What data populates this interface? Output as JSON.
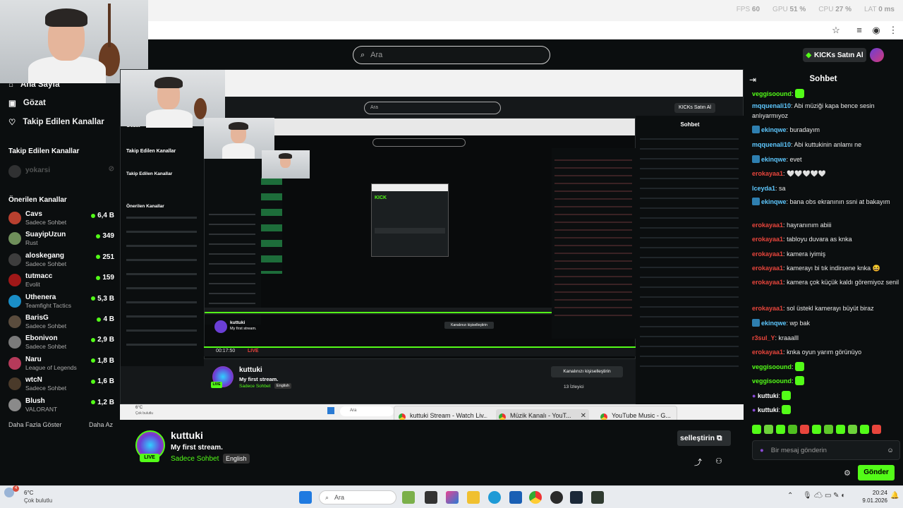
{
  "stats": {
    "fps_label": "FPS",
    "fps": "60",
    "gpu_label": "GPU",
    "gpu": "51 %",
    "cpu_label": "CPU",
    "cpu": "27 %",
    "lat_label": "LAT",
    "lat": "0 ms"
  },
  "search": {
    "placeholder": "Ara"
  },
  "header": {
    "buy_kicks": "KICKs Satın Al"
  },
  "sidebar": {
    "nav": [
      {
        "label": "Ana Sayfa",
        "icon": "home-icon"
      },
      {
        "label": "Gözat",
        "icon": "browse-icon"
      },
      {
        "label": "Takip Edilen Kanallar",
        "icon": "heart-icon"
      }
    ],
    "followed_title": "Takip Edilen Kanallar",
    "followed": [
      {
        "name": "yokarsi"
      }
    ],
    "recommended_title": "Önerilen Kanallar",
    "recommended": [
      {
        "name": "Cavs",
        "category": "Sadece Sohbet",
        "viewers": "6,4 B",
        "color": "#b8402f"
      },
      {
        "name": "SuayipUzun",
        "category": "Rust",
        "viewers": "349",
        "color": "#6f8f5a"
      },
      {
        "name": "aloskegang",
        "category": "Sadece Sohbet",
        "viewers": "251",
        "color": "#3d3d3d"
      },
      {
        "name": "tutmacc",
        "category": "Evolit",
        "viewers": "159",
        "color": "#a01818"
      },
      {
        "name": "Uthenera",
        "category": "Teamfight Tactics",
        "viewers": "5,3 B",
        "color": "#1a8ec7"
      },
      {
        "name": "BarisG",
        "category": "Sadece Sohbet",
        "viewers": "4 B",
        "color": "#5a4c3d"
      },
      {
        "name": "Ebonivon",
        "category": "Sadece Sohbet",
        "viewers": "2,9 B",
        "color": "#7a7a7a"
      },
      {
        "name": "Naru",
        "category": "League of Legends",
        "viewers": "1,8 B",
        "color": "#b53a5a"
      },
      {
        "name": "wtcN",
        "category": "Sadece Sohbet",
        "viewers": "1,6 B",
        "color": "#4a3a2a"
      },
      {
        "name": "Blush",
        "category": "VALORANT",
        "viewers": "1,2 B",
        "color": "#8a8a8a"
      }
    ],
    "show_more": "Daha Fazla Göster",
    "show_less": "Daha Az"
  },
  "stream": {
    "channel": "kuttuki",
    "title": "My first stream.",
    "category": "Sadece Sohbet",
    "language": "English",
    "live": "LIVE",
    "customize": "Kanalınızı kişiselleştirin",
    "customize_partial": "selleştirin",
    "viewers": "13 İzleyici",
    "time": "00:17:50"
  },
  "taskbar_overlay": {
    "weather_temp": "6°C",
    "weather_desc": "Çok bulutlu",
    "search": "Ara",
    "thumbs": [
      {
        "title": "kuttuki Stream - Watch Liv..."
      },
      {
        "title": "Müzik Kanalı - YouT..."
      },
      {
        "title": "YouTube Music - G..."
      }
    ]
  },
  "chat": {
    "title": "Sohbet",
    "messages": [
      {
        "user": "veggisoound",
        "text": "",
        "color": "#53fc18",
        "emote": true
      },
      {
        "user": "mqquenali10",
        "text": "Abi müziği kapa bence sesin anlıyarmıyoz",
        "color": "#5ec8ff"
      },
      {
        "user": "ekinqwe",
        "text": "buradayım",
        "color": "#5ec8ff",
        "badge": true
      },
      {
        "user": "mqquenali10",
        "text": "Abi kuttukinin anlamı ne",
        "color": "#5ec8ff"
      },
      {
        "user": "ekinqwe",
        "text": "evet",
        "color": "#5ec8ff",
        "badge": true
      },
      {
        "user": "erokayaa1",
        "text": "🤍🤍🤍🤍🤍",
        "color": "#e8453c"
      },
      {
        "user": "lceyda1",
        "text": "sa",
        "color": "#5ec8ff"
      },
      {
        "user": "ekinqwe",
        "text": "bana obs ekranının ssni at bakayım",
        "color": "#5ec8ff",
        "badge": true
      },
      {
        "user": "erokayaa1",
        "text": "hayranınım abiii",
        "color": "#e8453c"
      },
      {
        "user": "erokayaa1",
        "text": "tabloyu duvara as knka",
        "color": "#e8453c"
      },
      {
        "user": "erokayaa1",
        "text": "kamera iyimiş",
        "color": "#e8453c"
      },
      {
        "user": "erokayaa1",
        "text": "kamerayı bi tık indirsene knka 😆",
        "color": "#e8453c"
      },
      {
        "user": "erokayaa1",
        "text": "kamera çok küçük kaldı göremiyoz senil",
        "color": "#e8453c"
      },
      {
        "user": "erokayaa1",
        "text": "sol üstekl kamerayı büyüt biraz",
        "color": "#e8453c"
      },
      {
        "user": "ekinqwe",
        "text": "wp bak",
        "color": "#5ec8ff",
        "badge": true
      },
      {
        "user": "r3sul_Y",
        "text": "kraaalll",
        "color": "#e8453c"
      },
      {
        "user": "erokayaa1",
        "text": "knka oyun yarım görünüyo",
        "color": "#e8453c"
      },
      {
        "user": "veggisoound",
        "text": "",
        "color": "#53fc18",
        "emote": true
      },
      {
        "user": "veggisoound",
        "text": "",
        "color": "#53fc18",
        "emote": true
      },
      {
        "user": "kuttuki",
        "text": "",
        "color": "#ffffff",
        "emote": true
      },
      {
        "user": "kuttuki",
        "text": "",
        "color": "#ffffff",
        "emote": true
      }
    ],
    "input_placeholder": "Bir mesaj gönderin",
    "send": "Gönder"
  },
  "win_taskbar": {
    "weather_temp": "6°C",
    "weather_desc": "Çok bulutlu",
    "search": "Ara",
    "time": "20:24",
    "date": "9.01.2026"
  }
}
